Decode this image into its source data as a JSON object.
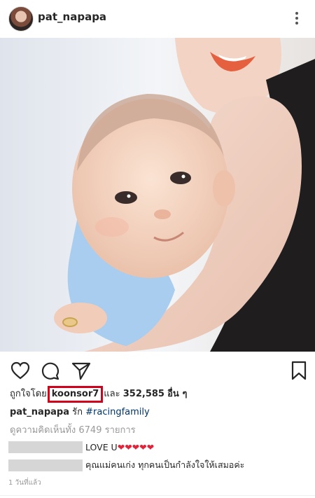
{
  "post": {
    "username": "pat_napapa",
    "more_icon": "more-vertical-icon"
  },
  "actions": {
    "icons": [
      "heart-icon",
      "comment-icon",
      "share-icon",
      "bookmark-icon"
    ]
  },
  "likes": {
    "prefix": "ถูกใจโดย",
    "liker": "koonsor7",
    "middle": "และ",
    "count": "352,585",
    "suffix": "อื่น ๆ",
    "highlight_color": "#d0021b"
  },
  "caption": {
    "username": "pat_napapa",
    "text": "รัก",
    "hashtag": "#racingfamily"
  },
  "view_comments": "ดูความคิดเห็นทั้ง 6749 รายการ",
  "comments": [
    {
      "text": "LOVE U",
      "hearts": "❤❤❤❤❤"
    },
    {
      "text": "คุณแม่คนเก่ง ทุกคนเป็นกำลังใจให้เสมอค่ะ",
      "hearts": ""
    }
  ],
  "timestamp": "1 วันที่แล้ว"
}
